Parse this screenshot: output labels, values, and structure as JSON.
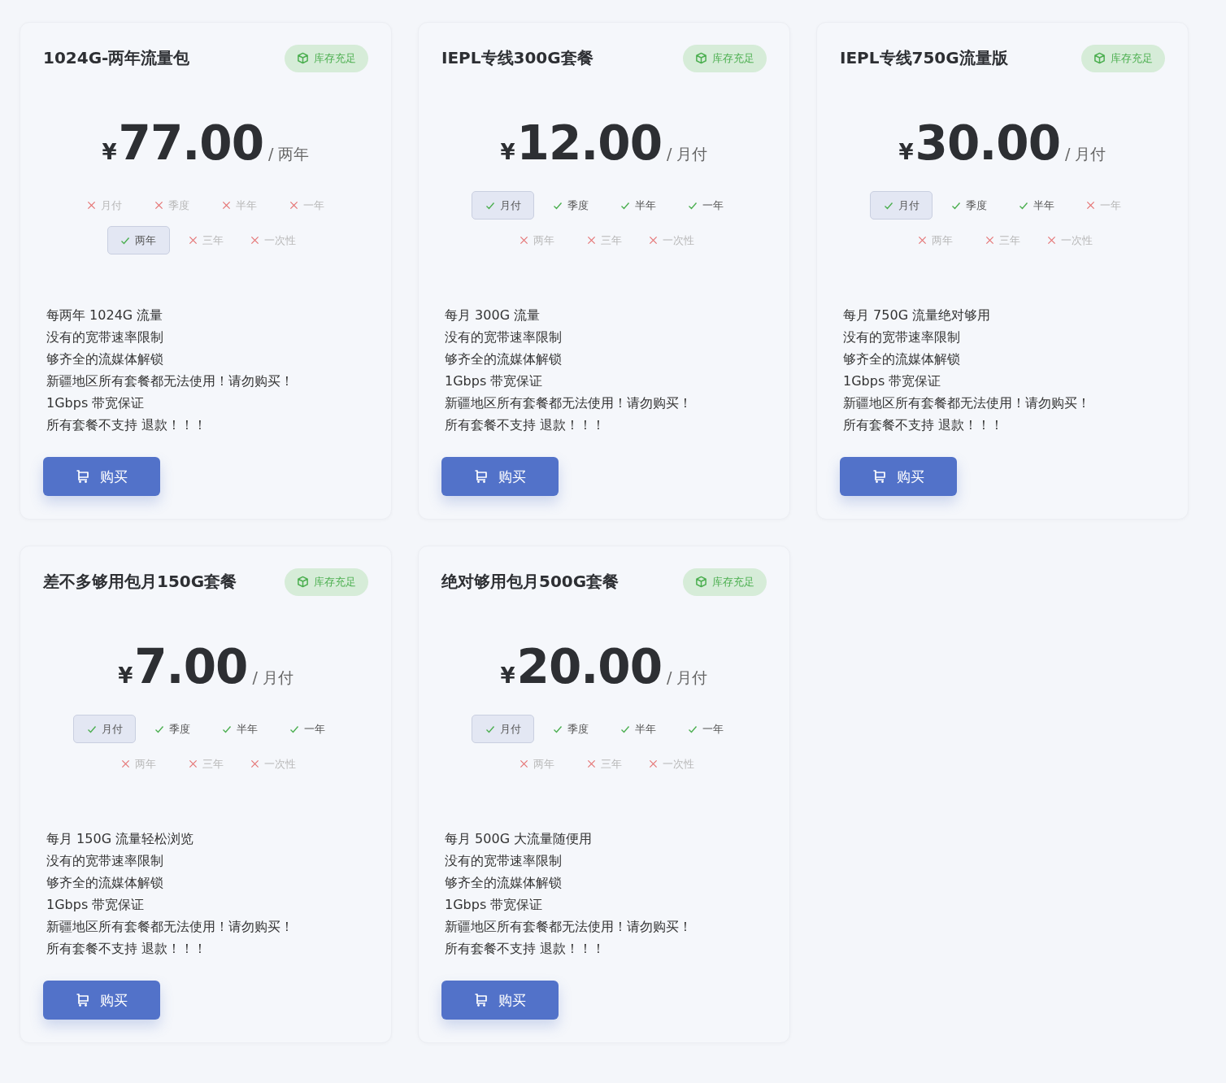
{
  "plans": [
    {
      "title": "1024G-两年流量包",
      "badge": "库存充足",
      "currency": "¥",
      "price": "77.00",
      "period": "/ 两年",
      "periods": [
        {
          "label": "月付",
          "available": false,
          "selected": false
        },
        {
          "label": "季度",
          "available": false,
          "selected": false
        },
        {
          "label": "半年",
          "available": false,
          "selected": false
        },
        {
          "label": "一年",
          "available": false,
          "selected": false
        },
        {
          "label": "两年",
          "available": true,
          "selected": true
        },
        {
          "label": "三年",
          "available": false,
          "selected": false
        },
        {
          "label": "一次性",
          "available": false,
          "selected": false
        }
      ],
      "features": [
        "每两年 1024G 流量",
        "没有的宽带速率限制",
        "够齐全的流媒体解锁",
        "新疆地区所有套餐都无法使用！请勿购买！",
        "1Gbps 带宽保证",
        "所有套餐不支持 退款！！！"
      ],
      "button": "购买"
    },
    {
      "title": "IEPL专线300G套餐",
      "badge": "库存充足",
      "currency": "¥",
      "price": "12.00",
      "period": "/ 月付",
      "periods": [
        {
          "label": "月付",
          "available": true,
          "selected": true
        },
        {
          "label": "季度",
          "available": true,
          "selected": false
        },
        {
          "label": "半年",
          "available": true,
          "selected": false
        },
        {
          "label": "一年",
          "available": true,
          "selected": false
        },
        {
          "label": "两年",
          "available": false,
          "selected": false
        },
        {
          "label": "三年",
          "available": false,
          "selected": false
        },
        {
          "label": "一次性",
          "available": false,
          "selected": false
        }
      ],
      "features": [
        "每月 300G 流量",
        "没有的宽带速率限制",
        "够齐全的流媒体解锁",
        "1Gbps 带宽保证",
        "新疆地区所有套餐都无法使用！请勿购买！",
        "所有套餐不支持 退款！！！"
      ],
      "button": "购买"
    },
    {
      "title": "IEPL专线750G流量版",
      "badge": "库存充足",
      "currency": "¥",
      "price": "30.00",
      "period": "/ 月付",
      "periods": [
        {
          "label": "月付",
          "available": true,
          "selected": true
        },
        {
          "label": "季度",
          "available": true,
          "selected": false
        },
        {
          "label": "半年",
          "available": true,
          "selected": false
        },
        {
          "label": "一年",
          "available": false,
          "selected": false
        },
        {
          "label": "两年",
          "available": false,
          "selected": false
        },
        {
          "label": "三年",
          "available": false,
          "selected": false
        },
        {
          "label": "一次性",
          "available": false,
          "selected": false
        }
      ],
      "features": [
        "每月 750G 流量绝对够用",
        "没有的宽带速率限制",
        "够齐全的流媒体解锁",
        "1Gbps 带宽保证",
        "新疆地区所有套餐都无法使用！请勿购买！",
        "所有套餐不支持 退款！！！"
      ],
      "button": "购买"
    },
    {
      "title": "差不多够用包月150G套餐",
      "badge": "库存充足",
      "currency": "¥",
      "price": "7.00",
      "period": "/ 月付",
      "periods": [
        {
          "label": "月付",
          "available": true,
          "selected": true
        },
        {
          "label": "季度",
          "available": true,
          "selected": false
        },
        {
          "label": "半年",
          "available": true,
          "selected": false
        },
        {
          "label": "一年",
          "available": true,
          "selected": false
        },
        {
          "label": "两年",
          "available": false,
          "selected": false
        },
        {
          "label": "三年",
          "available": false,
          "selected": false
        },
        {
          "label": "一次性",
          "available": false,
          "selected": false
        }
      ],
      "features": [
        "每月 150G 流量轻松浏览",
        "没有的宽带速率限制",
        "够齐全的流媒体解锁",
        "1Gbps 带宽保证",
        "新疆地区所有套餐都无法使用！请勿购买！",
        "所有套餐不支持 退款！！！"
      ],
      "button": "购买"
    },
    {
      "title": "绝对够用包月500G套餐",
      "badge": "库存充足",
      "currency": "¥",
      "price": "20.00",
      "period": "/ 月付",
      "periods": [
        {
          "label": "月付",
          "available": true,
          "selected": true
        },
        {
          "label": "季度",
          "available": true,
          "selected": false
        },
        {
          "label": "半年",
          "available": true,
          "selected": false
        },
        {
          "label": "一年",
          "available": true,
          "selected": false
        },
        {
          "label": "两年",
          "available": false,
          "selected": false
        },
        {
          "label": "三年",
          "available": false,
          "selected": false
        },
        {
          "label": "一次性",
          "available": false,
          "selected": false
        }
      ],
      "features": [
        "每月 500G 大流量随便用",
        "没有的宽带速率限制",
        "够齐全的流媒体解锁",
        "1Gbps 带宽保证",
        "新疆地区所有套餐都无法使用！请勿购买！",
        "所有套餐不支持 退款！！！"
      ],
      "button": "购买"
    }
  ]
}
